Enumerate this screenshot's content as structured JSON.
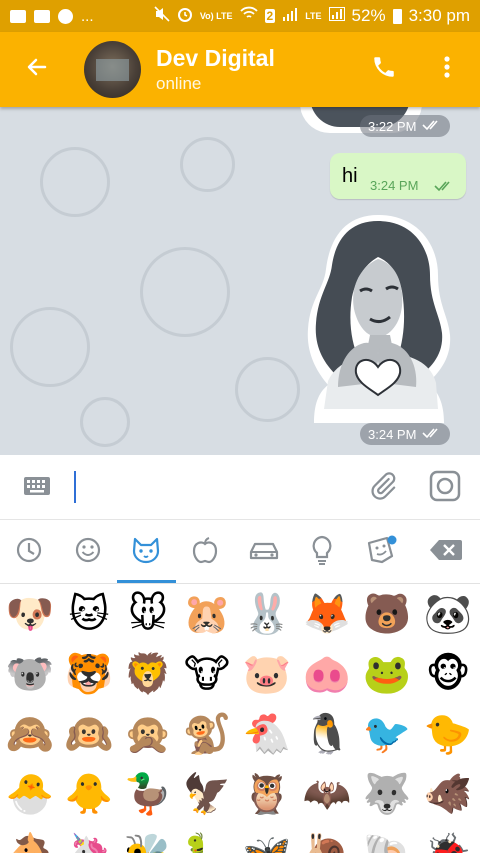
{
  "status_bar": {
    "left_icons": [
      "gallery-icon",
      "email-icon",
      "whatsapp-icon"
    ],
    "ellipsis": "...",
    "volte_label": "Vo) LTE",
    "sim_badge": "2",
    "lte_label": "LTE",
    "battery_percent": "52%",
    "time": "3:30 pm"
  },
  "header": {
    "contact_name": "Dev Digital",
    "contact_status": "online",
    "accent_color": "#fbb200"
  },
  "messages": [
    {
      "type": "sticker",
      "direction": "incoming",
      "time": "3:22 PM",
      "read": true
    },
    {
      "type": "text",
      "direction": "outgoing",
      "text": "hi",
      "time": "3:24 PM",
      "read": true
    },
    {
      "type": "sticker",
      "direction": "incoming",
      "time": "3:24 PM",
      "read": true
    }
  ],
  "input": {
    "value": "",
    "icons": [
      "keyboard-icon",
      "attach-icon",
      "camera-icon"
    ]
  },
  "emoji_tabs": {
    "items": [
      "recent-icon",
      "smileys-icon",
      "animals-icon",
      "food-icon",
      "travel-icon",
      "objects-icon",
      "stickers-icon",
      "backspace-icon"
    ],
    "selected": "animals-icon",
    "selected_color": "#3390d8"
  },
  "emoji_rows": [
    [
      "🐶",
      "🐱",
      "🐭",
      "🐹",
      "🐰",
      "🦊",
      "🐻",
      "🐼"
    ],
    [
      "🐨",
      "🐯",
      "🦁",
      "🐮",
      "🐷",
      "🐽",
      "🐸",
      "🐵"
    ],
    [
      "🙈",
      "🙉",
      "🙊",
      "🐒",
      "🐔",
      "🐧",
      "🐦",
      "🐤"
    ],
    [
      "🐣",
      "🐥",
      "🦆",
      "🦅",
      "🦉",
      "🦇",
      "🐺",
      "🐗"
    ],
    [
      "🐴",
      "🦄",
      "🐝",
      "🐛",
      "🦋",
      "🐌",
      "🐚",
      "🐞"
    ]
  ]
}
